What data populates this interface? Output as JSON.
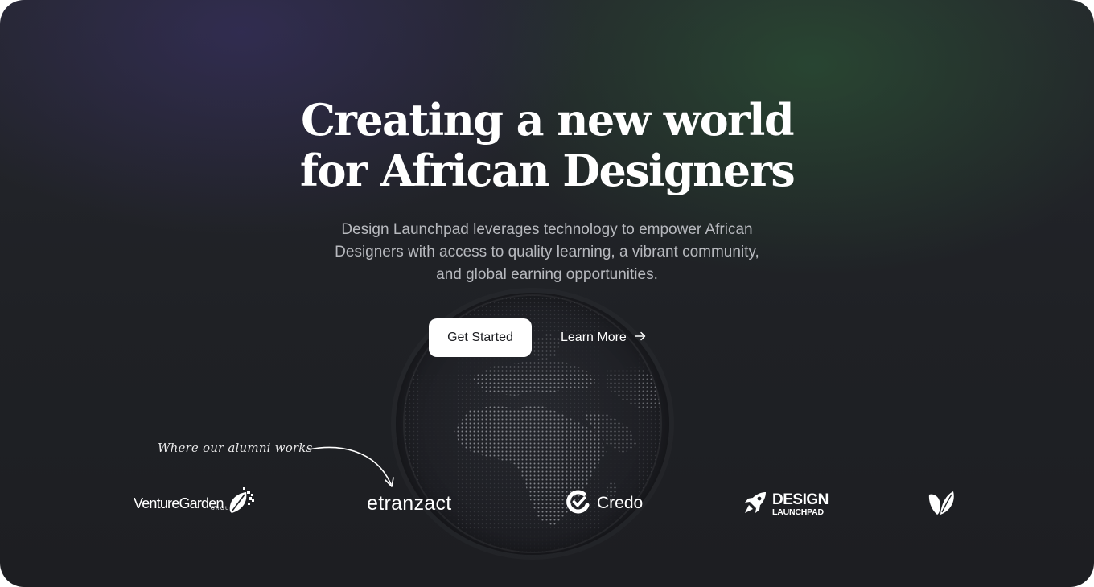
{
  "hero": {
    "title_line1": "Creating a new world",
    "title_line2": "for African Designers",
    "subtitle": "Design Launchpad leverages technology to empower African Designers with access to quality learning, a vibrant community, and global earning opportunities.",
    "primary_cta": "Get Started",
    "secondary_cta": "Learn More"
  },
  "alumni": {
    "label": "Where our alumni works",
    "logos": {
      "venture_garden": "VentureGarden",
      "venture_garden_sub": "GROUP",
      "etranzact": "etranzact",
      "credo": "Credo",
      "design_launchpad_top": "DESIGN",
      "design_launchpad_bottom": "LAUNCHPAD"
    }
  },
  "icons": {
    "learn_more": "arrow-right-icon",
    "globe": "dotted-globe-africa-icon",
    "credo": "credo-check-icon",
    "design_launchpad": "rocket-icon",
    "fifth_logo": "leaf-icon",
    "venture_garden": "pixel-leaf-icon"
  },
  "colors": {
    "background": "#1f2125",
    "primary_button_bg": "#ffffff",
    "primary_button_text": "#1b1c20",
    "subtitle": "#b7b9be"
  }
}
